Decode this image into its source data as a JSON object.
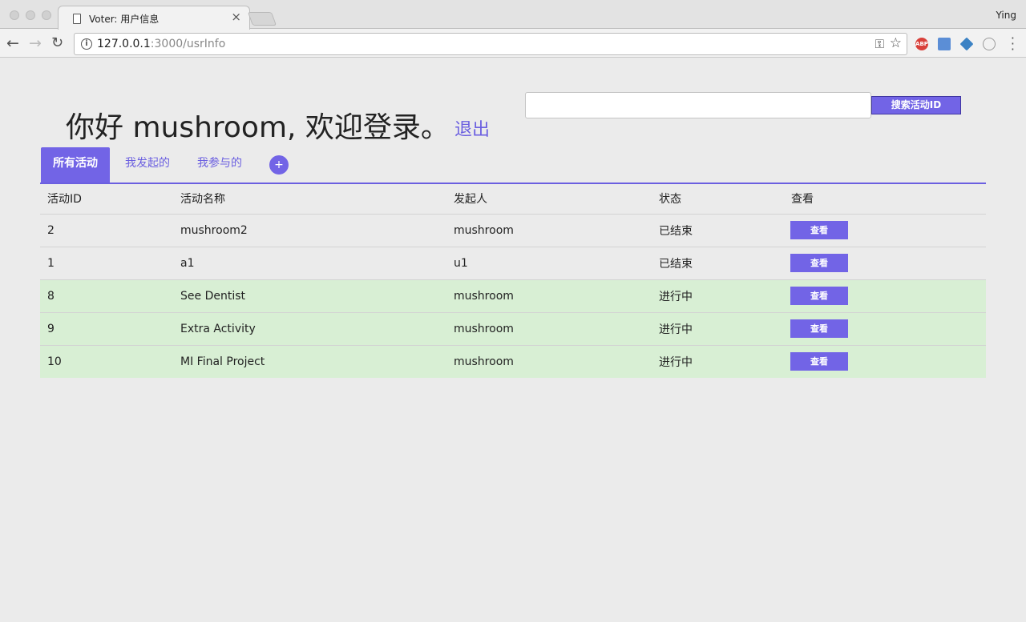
{
  "browser": {
    "tab_title": "Voter: 用户信息",
    "profile_name": "Ying",
    "url_host": "127.0.0.1",
    "url_rest": ":3000/usrInfo",
    "ext_abp_label": "ABP"
  },
  "header": {
    "greeting": "你好 mushroom, 欢迎登录。",
    "logout_label": "退出"
  },
  "search": {
    "value": "",
    "button_label": "搜索活动ID"
  },
  "tabs": [
    {
      "label": "所有活动",
      "active": true
    },
    {
      "label": "我发起的",
      "active": false
    },
    {
      "label": "我参与的",
      "active": false
    }
  ],
  "add_button_label": "+",
  "table": {
    "headers": [
      "活动ID",
      "活动名称",
      "发起人",
      "状态",
      "查看"
    ],
    "rows": [
      {
        "id": "2",
        "name": "mushroom2",
        "initiator": "mushroom",
        "status": "已结束",
        "action": "查看"
      },
      {
        "id": "1",
        "name": "a1",
        "initiator": "u1",
        "status": "已结束",
        "action": "查看"
      },
      {
        "id": "8",
        "name": "See Dentist",
        "initiator": "mushroom",
        "status": "进行中",
        "action": "查看"
      },
      {
        "id": "9",
        "name": "Extra Activity",
        "initiator": "mushroom",
        "status": "进行中",
        "action": "查看"
      },
      {
        "id": "10",
        "name": "MI Final Project",
        "initiator": "mushroom",
        "status": "进行中",
        "action": "查看"
      }
    ]
  },
  "colors": {
    "accent": "#7264e6",
    "active_row": "#d8efd4",
    "background": "#ebebeb"
  },
  "icons": [
    "back-arrow-icon",
    "forward-arrow-icon",
    "reload-icon",
    "info-icon",
    "key-icon",
    "star-icon",
    "menu-icon",
    "document-icon",
    "close-icon",
    "plus-icon"
  ]
}
